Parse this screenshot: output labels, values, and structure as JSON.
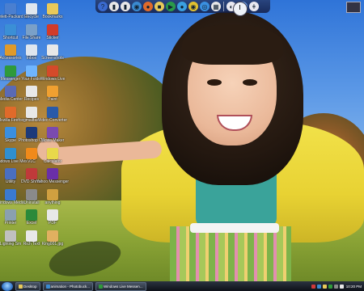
{
  "desktop_icons": [
    {
      "label": "Hewlett-Packard Utility",
      "color": "#4a7fd0"
    },
    {
      "label": "Recycle",
      "color": "#dfe6ee"
    },
    {
      "label": "Bookmarks",
      "color": "#e8c95a"
    },
    {
      "label": "Shortcut",
      "color": "#3b8fd6"
    },
    {
      "label": "File Share",
      "color": "#7aa0c8"
    },
    {
      "label": "Sticker",
      "color": "#d23b2a"
    },
    {
      "label": "Accessories",
      "color": "#e09a2a"
    },
    {
      "label": "Inbox",
      "color": "#dfe6ee"
    },
    {
      "label": "Screenshots",
      "color": "#e8e8e8"
    },
    {
      "label": "Messenger",
      "color": "#2f9a3a"
    },
    {
      "label": "Your Folder",
      "color": "#6fb5ff"
    },
    {
      "label": "Windows Live",
      "color": "#d44a2a"
    },
    {
      "label": "Media Center",
      "color": "#5a6ab5"
    },
    {
      "label": "Recipes",
      "color": "#e8e8e8"
    },
    {
      "label": "Paint",
      "color": "#f0a030"
    },
    {
      "label": "Mozilla Firefox",
      "color": "#e06a2a"
    },
    {
      "label": "gmailfast",
      "color": "#e8e8e8"
    },
    {
      "label": "Video Converter",
      "color": "#2a5aa8"
    },
    {
      "label": "Skype",
      "color": "#3a8fe0"
    },
    {
      "label": "Photoshop CS",
      "color": "#1c3a7a"
    },
    {
      "label": "Movie Maker",
      "color": "#7a4ab0"
    },
    {
      "label": "Windows Live Messenger",
      "color": "#2f8fd0"
    },
    {
      "label": "VLC",
      "color": "#f08a1a"
    },
    {
      "label": "Calculator",
      "color": "#e8d84a"
    },
    {
      "label": "Utility",
      "color": "#4a6fc0"
    },
    {
      "label": "DVD Shrink",
      "color": "#c03a3a"
    },
    {
      "label": "Yahoo Messenger",
      "color": "#6a2fa8"
    },
    {
      "label": "Windows Media",
      "color": "#3a7ad0"
    },
    {
      "label": "Uninstall",
      "color": "#8a8a8a"
    },
    {
      "label": "anything",
      "color": "#d0a040"
    },
    {
      "label": "Printer",
      "color": "#8aa0b0"
    },
    {
      "label": "Excel",
      "color": "#2a8a3a"
    },
    {
      "label": "PDF",
      "color": "#e8e8e8"
    },
    {
      "label": "Lighting Sm",
      "color": "#c0c0c0"
    },
    {
      "label": "Rich Text",
      "color": "#e8e8e8"
    },
    {
      "label": "King001.jpg",
      "color": "#e0b060"
    }
  ],
  "quick_launch": [
    {
      "name": "help-icon",
      "glyph": "?",
      "color": "#3a6ad0"
    },
    {
      "name": "document-icon",
      "glyph": "▮",
      "color": "#e8e8e8"
    },
    {
      "name": "document-icon",
      "glyph": "▮",
      "color": "#e8e8e8"
    },
    {
      "name": "globe-icon",
      "glyph": "◉",
      "color": "#3a8ad0"
    },
    {
      "name": "firefox-icon",
      "glyph": "●",
      "color": "#e06a2a"
    },
    {
      "name": "folder-icon",
      "glyph": "■",
      "color": "#e8c95a"
    },
    {
      "name": "media-icon",
      "glyph": "▶",
      "color": "#2a9a4a"
    },
    {
      "name": "chat-icon",
      "glyph": "●",
      "color": "#3aa0e0"
    },
    {
      "name": "chrome-icon",
      "glyph": "◉",
      "color": "#e0c030"
    },
    {
      "name": "network-icon",
      "glyph": "◎",
      "color": "#3a90e0"
    },
    {
      "name": "calendar-icon",
      "glyph": "▦",
      "color": "#e8e8e8"
    }
  ],
  "quick_launch_extra": [
    {
      "name": "moon-icon",
      "glyph": "◐",
      "color": "#e8e8f0"
    },
    {
      "name": "toggle-icon",
      "glyph": "◧",
      "color": "#6a9ae0"
    },
    {
      "name": "key-icon",
      "glyph": "ǂ",
      "color": "#e8e8f0"
    }
  ],
  "taskbar": {
    "buttons": [
      {
        "label": "Desktop",
        "color": "#e8c95a"
      },
      {
        "label": "animation - Photobuck...",
        "color": "#3a8ad0"
      },
      {
        "label": "Windows Live Messen...",
        "color": "#2f9a3a"
      }
    ],
    "tray_colors": [
      "#d03a3a",
      "#3a8ad0",
      "#e8c95a",
      "#2f9a3a",
      "#8a8a8a",
      "#e8e8e8"
    ],
    "time": "10:20 PM"
  }
}
